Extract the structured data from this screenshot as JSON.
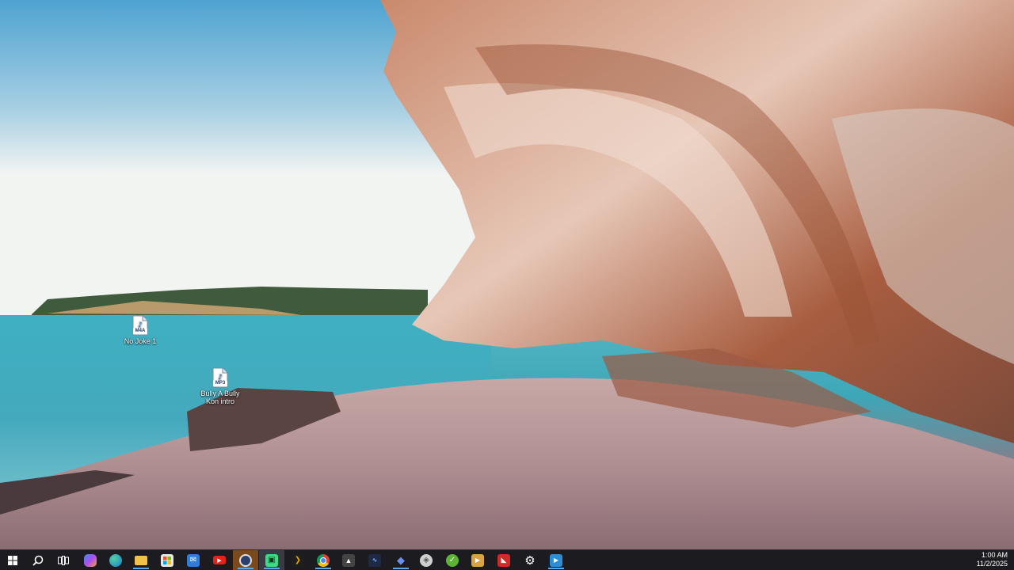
{
  "desktop": {
    "icons": [
      {
        "name": "No Joke 1",
        "type_badge": "M4A"
      },
      {
        "name": "Bully A Bully Kon intro",
        "type_badge": "MP3"
      }
    ]
  },
  "taskbar": {
    "start_icon": "windows-logo-icon",
    "search_icon": "search-icon",
    "task_view_icon": "task-view-icon",
    "apps": [
      {
        "id": "copilot",
        "icon": "copilot-icon",
        "color": "#7b5cf0"
      },
      {
        "id": "edge",
        "icon": "edge-icon",
        "color": "#1f9e7a"
      },
      {
        "id": "file-explorer",
        "icon": "folder-icon",
        "color": "#f0c24a"
      },
      {
        "id": "store",
        "icon": "store-icon",
        "color": "#e8e8e8"
      },
      {
        "id": "outlook",
        "icon": "mail-icon",
        "color": "#2f7fd8"
      },
      {
        "id": "youtube",
        "icon": "youtube-icon",
        "color": "#e62117"
      },
      {
        "id": "app-circle",
        "icon": "circle-app-icon",
        "color": "#2c3e6e"
      },
      {
        "id": "android-app",
        "icon": "android-icon",
        "color": "#3ddc84"
      },
      {
        "id": "plex",
        "icon": "plex-icon",
        "color": "#e5a00d"
      },
      {
        "id": "chrome",
        "icon": "chrome-icon",
        "color": "#4285f4"
      },
      {
        "id": "unity",
        "icon": "triangle-app-icon",
        "color": "#444444"
      },
      {
        "id": "audio-editor",
        "icon": "waveform-icon",
        "color": "#1e2a44"
      },
      {
        "id": "app-diamond",
        "icon": "diamond-app-icon",
        "color": "#4b70d8"
      },
      {
        "id": "app-shield",
        "icon": "shield-app-icon",
        "color": "#cfcfcf"
      },
      {
        "id": "app-green-phone",
        "icon": "green-app-icon",
        "color": "#5bb532"
      },
      {
        "id": "app-video",
        "icon": "video-app-icon",
        "color": "#d9a441"
      },
      {
        "id": "app-red",
        "icon": "red-app-icon",
        "color": "#d12a2a"
      },
      {
        "id": "settings",
        "icon": "gear-icon",
        "color": "#e8e8e8"
      },
      {
        "id": "app-media",
        "icon": "media-app-icon",
        "color": "#2a8fd8"
      }
    ],
    "clock": {
      "time": "1:00 AM",
      "date": "11/2/2025"
    }
  }
}
